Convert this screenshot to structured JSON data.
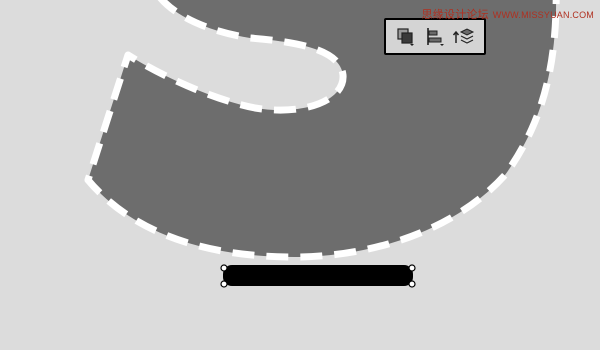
{
  "canvas": {
    "background_color": "#dcdcdc"
  },
  "shape": {
    "name": "letter-s-shape",
    "fill_color": "#6d6d6d",
    "stroke_color": "#ffffff",
    "stroke_style": "dashed"
  },
  "selected_rect": {
    "fill_color": "#000000",
    "handle_color": "#ffffff"
  },
  "toolbar": {
    "buttons": [
      {
        "icon": "path-operations-icon"
      },
      {
        "icon": "path-alignment-icon"
      },
      {
        "icon": "path-arrangement-icon"
      }
    ]
  },
  "watermark": {
    "site_name": "思缘设计论坛",
    "url": "WWW.MISSYUAN.COM"
  }
}
